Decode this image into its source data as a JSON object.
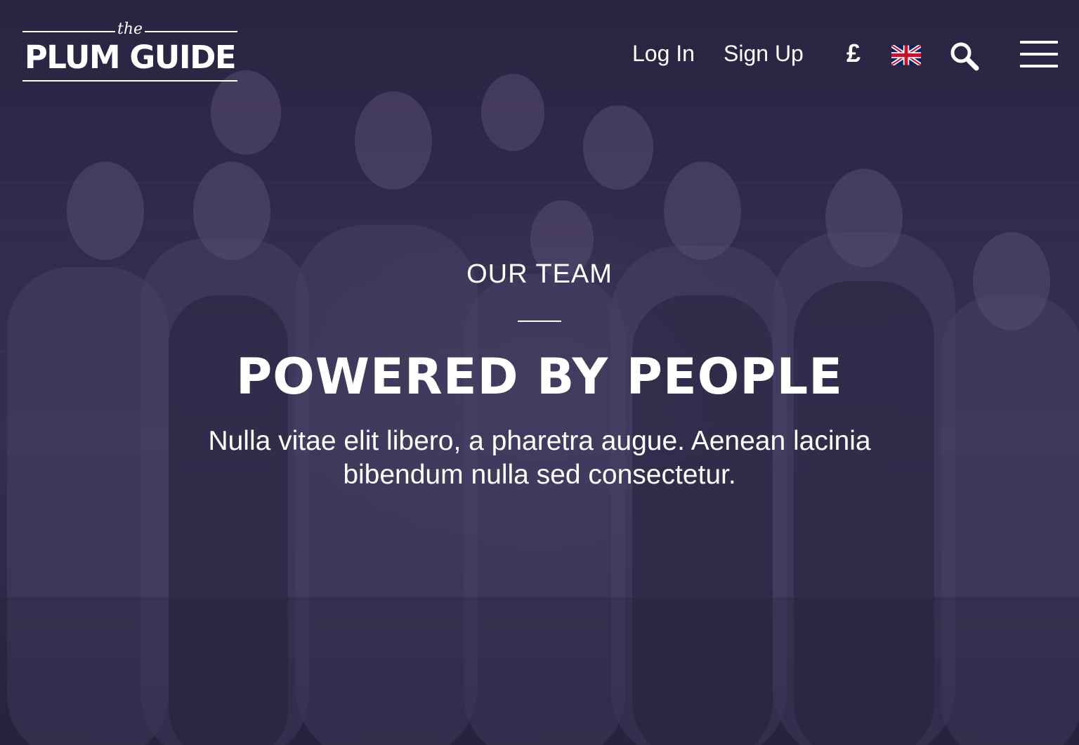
{
  "header": {
    "logo": {
      "the": "the",
      "name": "PLUM GUIDE"
    },
    "nav": {
      "login": "Log In",
      "signup": "Sign Up"
    },
    "currency": "£",
    "flag_icon": "uk-flag-icon",
    "search_icon": "search-icon",
    "menu_icon": "hamburger-menu-icon"
  },
  "hero": {
    "eyebrow": "OUR TEAM",
    "headline": "POWERED BY PEOPLE",
    "subtext": "Nulla vitae elit libero, a pharetra augue. Aenean lacinia bibendum nulla sed consectetur."
  },
  "colors": {
    "overlay": "#2e2a45",
    "text": "#ffffff"
  }
}
